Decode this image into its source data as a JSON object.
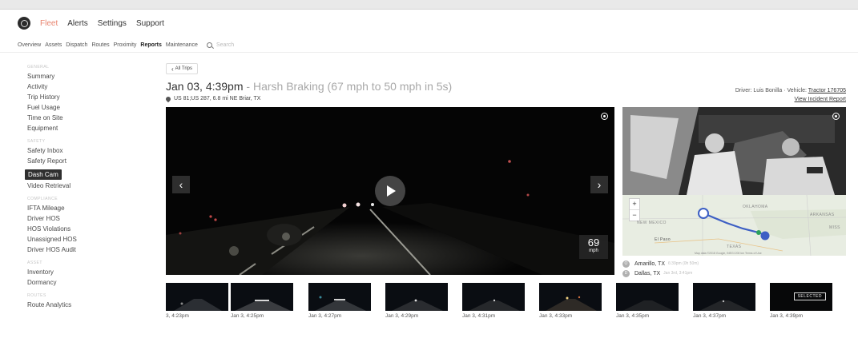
{
  "top_nav": {
    "items": [
      "Fleet",
      "Alerts",
      "Settings",
      "Support"
    ]
  },
  "sub_nav": {
    "items": [
      "Overview",
      "Assets",
      "Dispatch",
      "Routes",
      "Proximity",
      "Reports",
      "Maintenance"
    ],
    "active": "Reports",
    "search_placeholder": "Search"
  },
  "sidebar": {
    "sections": [
      {
        "heading": "GENERAL",
        "items": [
          "Summary",
          "Activity",
          "Trip History",
          "Fuel Usage",
          "Time on Site",
          "Equipment"
        ]
      },
      {
        "heading": "SAFETY",
        "items": [
          "Safety Inbox",
          "Safety Report",
          "Dash Cam",
          "Video Retrieval"
        ]
      },
      {
        "heading": "COMPLIANCE",
        "items": [
          "IFTA Mileage",
          "Driver HOS",
          "HOS Violations",
          "Unassigned HOS",
          "Driver HOS Audit"
        ]
      },
      {
        "heading": "ASSET",
        "items": [
          "Inventory",
          "Dormancy"
        ]
      },
      {
        "heading": "ROUTES",
        "items": [
          "Route Analytics"
        ]
      }
    ],
    "active_item": "Dash Cam"
  },
  "trip": {
    "back_label": "All Trips",
    "date_time": "Jan 03, 4:39pm",
    "separator": " - ",
    "event": "Harsh Braking (67 mph to 50 mph in 5s)",
    "location": "US 81;US 287, 6.8 mi NE Briar, TX",
    "driver_prefix": "Driver: ",
    "driver": "Luis Bonilla",
    "vehicle_prefix": " · Vehicle: ",
    "vehicle": "Tractor 176705",
    "report_link": "View Incident Report"
  },
  "video": {
    "speed": "69",
    "speed_unit": "mph"
  },
  "map": {
    "labels": [
      "OKLAHOMA",
      "ARKANSAS",
      "NEW MEXICO",
      "El Paso",
      "TEXAS",
      "MISS"
    ],
    "footer": "Map data ©2018 Google, INEGI   200 km   Terms of Use",
    "zoom_in": "+",
    "zoom_out": "−"
  },
  "route": {
    "origin": {
      "marker": "O",
      "city": "Amarillo, TX",
      "time": "6:39pm (0h 50m)"
    },
    "destination": {
      "marker": "D",
      "city": "Dallas, TX",
      "time": "Jan 3rd, 3:41pm"
    }
  },
  "thumbnails": [
    {
      "time": "3, 4:23pm"
    },
    {
      "time": "Jan 3, 4:25pm"
    },
    {
      "time": "Jan 3, 4:27pm"
    },
    {
      "time": "Jan 3, 4:29pm"
    },
    {
      "time": "Jan 3, 4:31pm"
    },
    {
      "time": "Jan 3, 4:33pm"
    },
    {
      "time": "Jan 3, 4:35pm"
    },
    {
      "time": "Jan 3, 4:37pm"
    },
    {
      "time": "Jan 3, 4:39pm"
    }
  ],
  "selected_label": "SELECTED",
  "colors": {
    "brand_active": "#e8846f",
    "route_line": "#3d5fc4",
    "active_sidebar_bg": "#2f2f2f"
  }
}
